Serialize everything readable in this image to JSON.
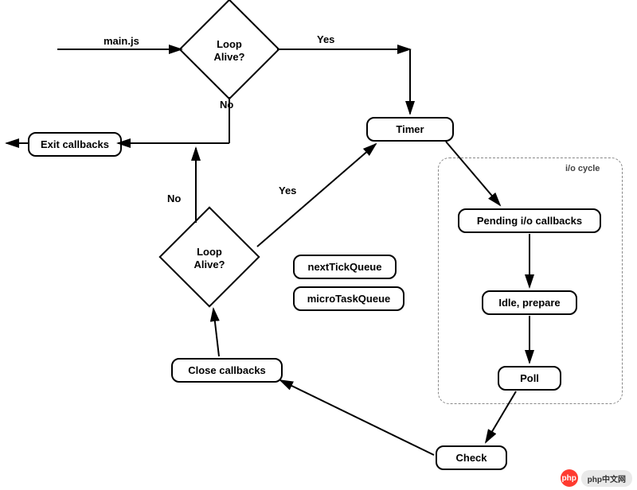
{
  "entry": {
    "label": "main.js"
  },
  "decision1": {
    "text": "Loop\nAlive?",
    "yes": "Yes",
    "no": "No"
  },
  "decision2": {
    "text": "Loop\nAlive?",
    "yes": "Yes",
    "no": "No"
  },
  "nodes": {
    "exit_callbacks": "Exit callbacks",
    "timer": "Timer",
    "pending_io": "Pending i/o callbacks",
    "idle_prepare": "Idle, prepare",
    "poll": "Poll",
    "check": "Check",
    "close_callbacks": "Close callbacks",
    "next_tick": "nextTickQueue",
    "microtask": "microTaskQueue"
  },
  "io_cycle_title": "i/o cycle",
  "watermark": {
    "logo": "php",
    "text": "php中文网"
  }
}
